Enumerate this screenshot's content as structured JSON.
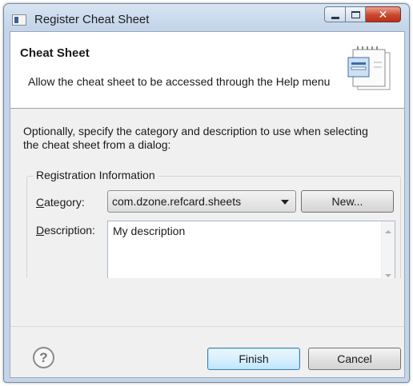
{
  "window": {
    "title": "Register Cheat Sheet",
    "controls": {
      "minimize": "minimize-icon",
      "maximize": "maximize-icon",
      "close": "✕"
    }
  },
  "header": {
    "title": "Cheat Sheet",
    "description": "Allow the cheat sheet to be accessed through the Help menu",
    "icon": "cheat-sheet-wizard-icon"
  },
  "intro": "Optionally, specify the category and description to use when selecting the cheat sheet from a dialog:",
  "registration": {
    "legend": "Registration Information",
    "category": {
      "label_mnemonic": "C",
      "label_rest": "ategory:",
      "selected": "com.dzone.refcard.sheets",
      "new_mnemonic": "N",
      "new_rest": "ew..."
    },
    "description": {
      "label_mnemonic": "D",
      "label_rest": "escription:",
      "value": "My description"
    }
  },
  "footer": {
    "help": "?",
    "finish": "Finish",
    "cancel": "Cancel"
  },
  "colors": {
    "accent_default_button": "#3c7fb1",
    "close_button": "#c9462b",
    "dialog_background": "#f0f0f0"
  }
}
